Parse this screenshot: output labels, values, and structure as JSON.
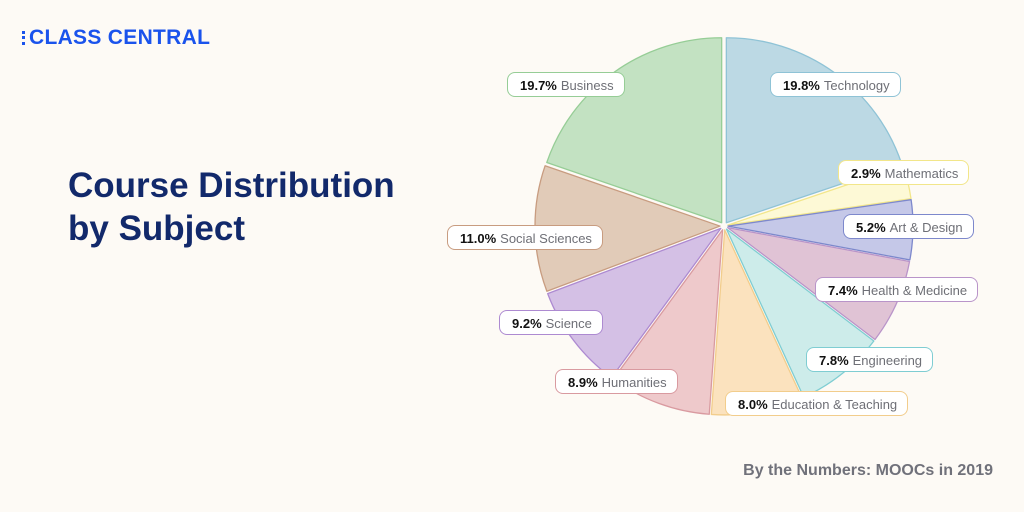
{
  "logo": {
    "text": "CLASS CENTRAL"
  },
  "title": {
    "line1": "Course Distribution",
    "line2": "by Subject"
  },
  "footer": {
    "text": "By the Numbers: MOOCs in 2019"
  },
  "chart_data": {
    "type": "pie",
    "title": "Course Distribution by Subject",
    "start": "top",
    "direction": "clockwise",
    "slices": [
      {
        "label": "Technology",
        "value": 19.8,
        "pct_text": "19.8%",
        "fill": "#bcd9e4",
        "stroke": "#8fc3d6"
      },
      {
        "label": "Mathematics",
        "value": 2.9,
        "pct_text": "2.9%",
        "fill": "#fdf9d6",
        "stroke": "#f2e68a"
      },
      {
        "label": "Art & Design",
        "value": 5.2,
        "pct_text": "5.2%",
        "fill": "#c5c8e8",
        "stroke": "#7d88cc"
      },
      {
        "label": "Health & Medicine",
        "value": 7.4,
        "pct_text": "7.4%",
        "fill": "#e0c3d5",
        "stroke": "#b994c9"
      },
      {
        "label": "Engineering",
        "value": 7.8,
        "pct_text": "7.8%",
        "fill": "#cdecea",
        "stroke": "#7fcdd2"
      },
      {
        "label": "Education & Teaching",
        "value": 8.0,
        "pct_text": "8.0%",
        "fill": "#fbe2be",
        "stroke": "#f2cd8c"
      },
      {
        "label": "Humanities",
        "value": 8.9,
        "pct_text": "8.9%",
        "fill": "#eec9cb",
        "stroke": "#d99aa0"
      },
      {
        "label": "Science",
        "value": 9.2,
        "pct_text": "9.2%",
        "fill": "#d4c0e5",
        "stroke": "#ad8ad1"
      },
      {
        "label": "Social Sciences",
        "value": 11.0,
        "pct_text": "11.0%",
        "fill": "#e1cbb8",
        "stroke": "#c89c80"
      },
      {
        "label": "Business",
        "value": 19.7,
        "pct_text": "19.7%",
        "fill": "#c3e2c2",
        "stroke": "#96cd96"
      }
    ]
  }
}
